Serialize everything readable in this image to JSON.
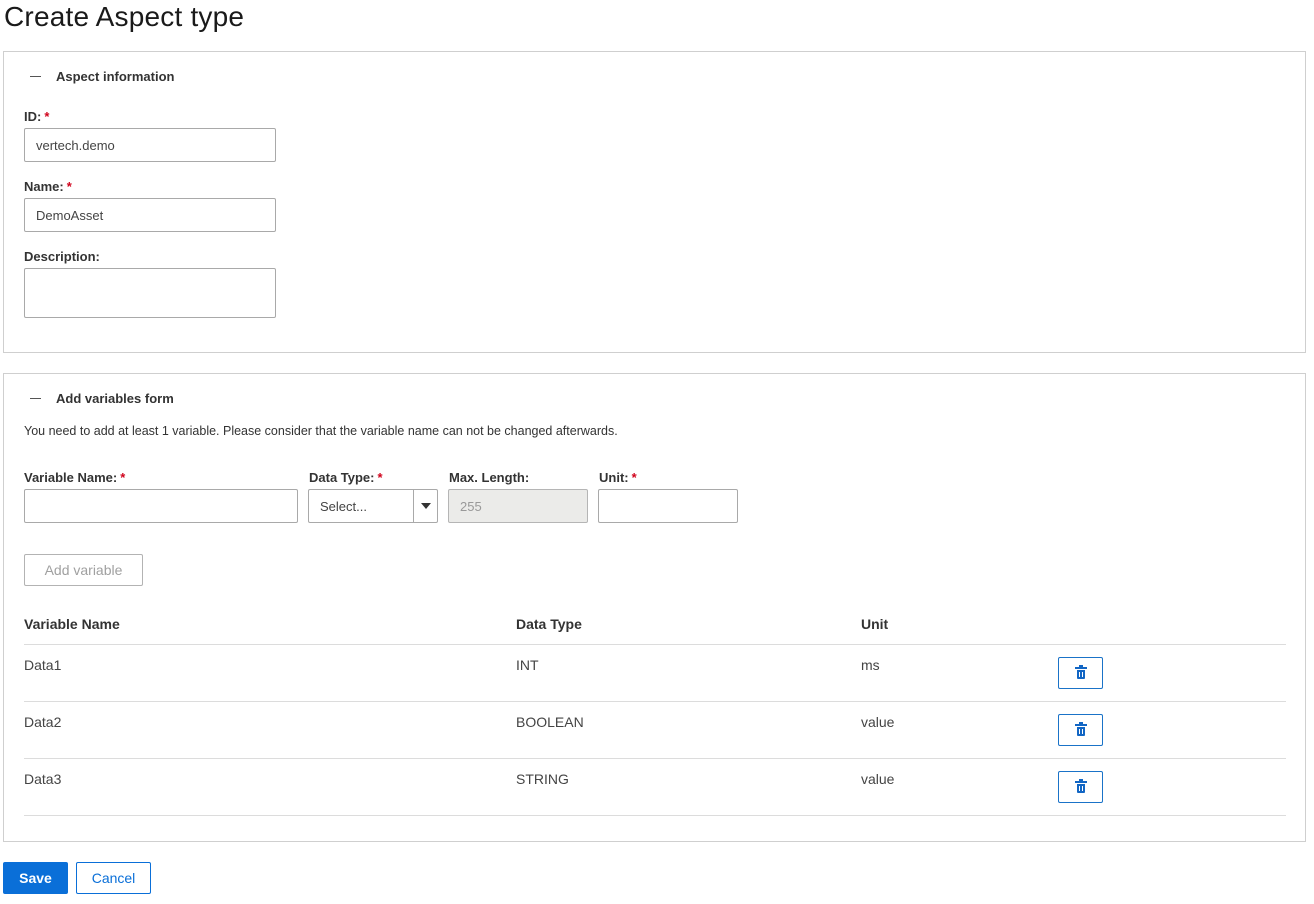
{
  "page": {
    "title": "Create Aspect type"
  },
  "aspect_info": {
    "header": "Aspect information",
    "id_label": "ID:",
    "id_value": "vertech.demo",
    "name_label": "Name:",
    "name_value": "DemoAsset",
    "description_label": "Description:",
    "description_value": "",
    "required_marker": "*"
  },
  "variables_form": {
    "header": "Add variables form",
    "hint": "You need to add at least 1 variable. Please consider that the variable name can not be changed afterwards.",
    "variable_name_label": "Variable Name:",
    "variable_name_value": "",
    "data_type_label": "Data Type:",
    "data_type_selected": "Select...",
    "max_length_label": "Max. Length:",
    "max_length_value": "255",
    "unit_label": "Unit:",
    "unit_value": "",
    "required_marker": "*",
    "add_button": "Add variable"
  },
  "table": {
    "columns": [
      "Variable Name",
      "Data Type",
      "Unit"
    ],
    "rows": [
      {
        "name": "Data1",
        "type": "INT",
        "unit": "ms"
      },
      {
        "name": "Data2",
        "type": "BOOLEAN",
        "unit": "value"
      },
      {
        "name": "Data3",
        "type": "STRING",
        "unit": "value"
      }
    ],
    "delete_icon": "trash-icon"
  },
  "actions": {
    "save": "Save",
    "cancel": "Cancel"
  },
  "colors": {
    "primary": "#0a6fd8",
    "required": "#d0021b",
    "border": "#cfcfcf"
  }
}
